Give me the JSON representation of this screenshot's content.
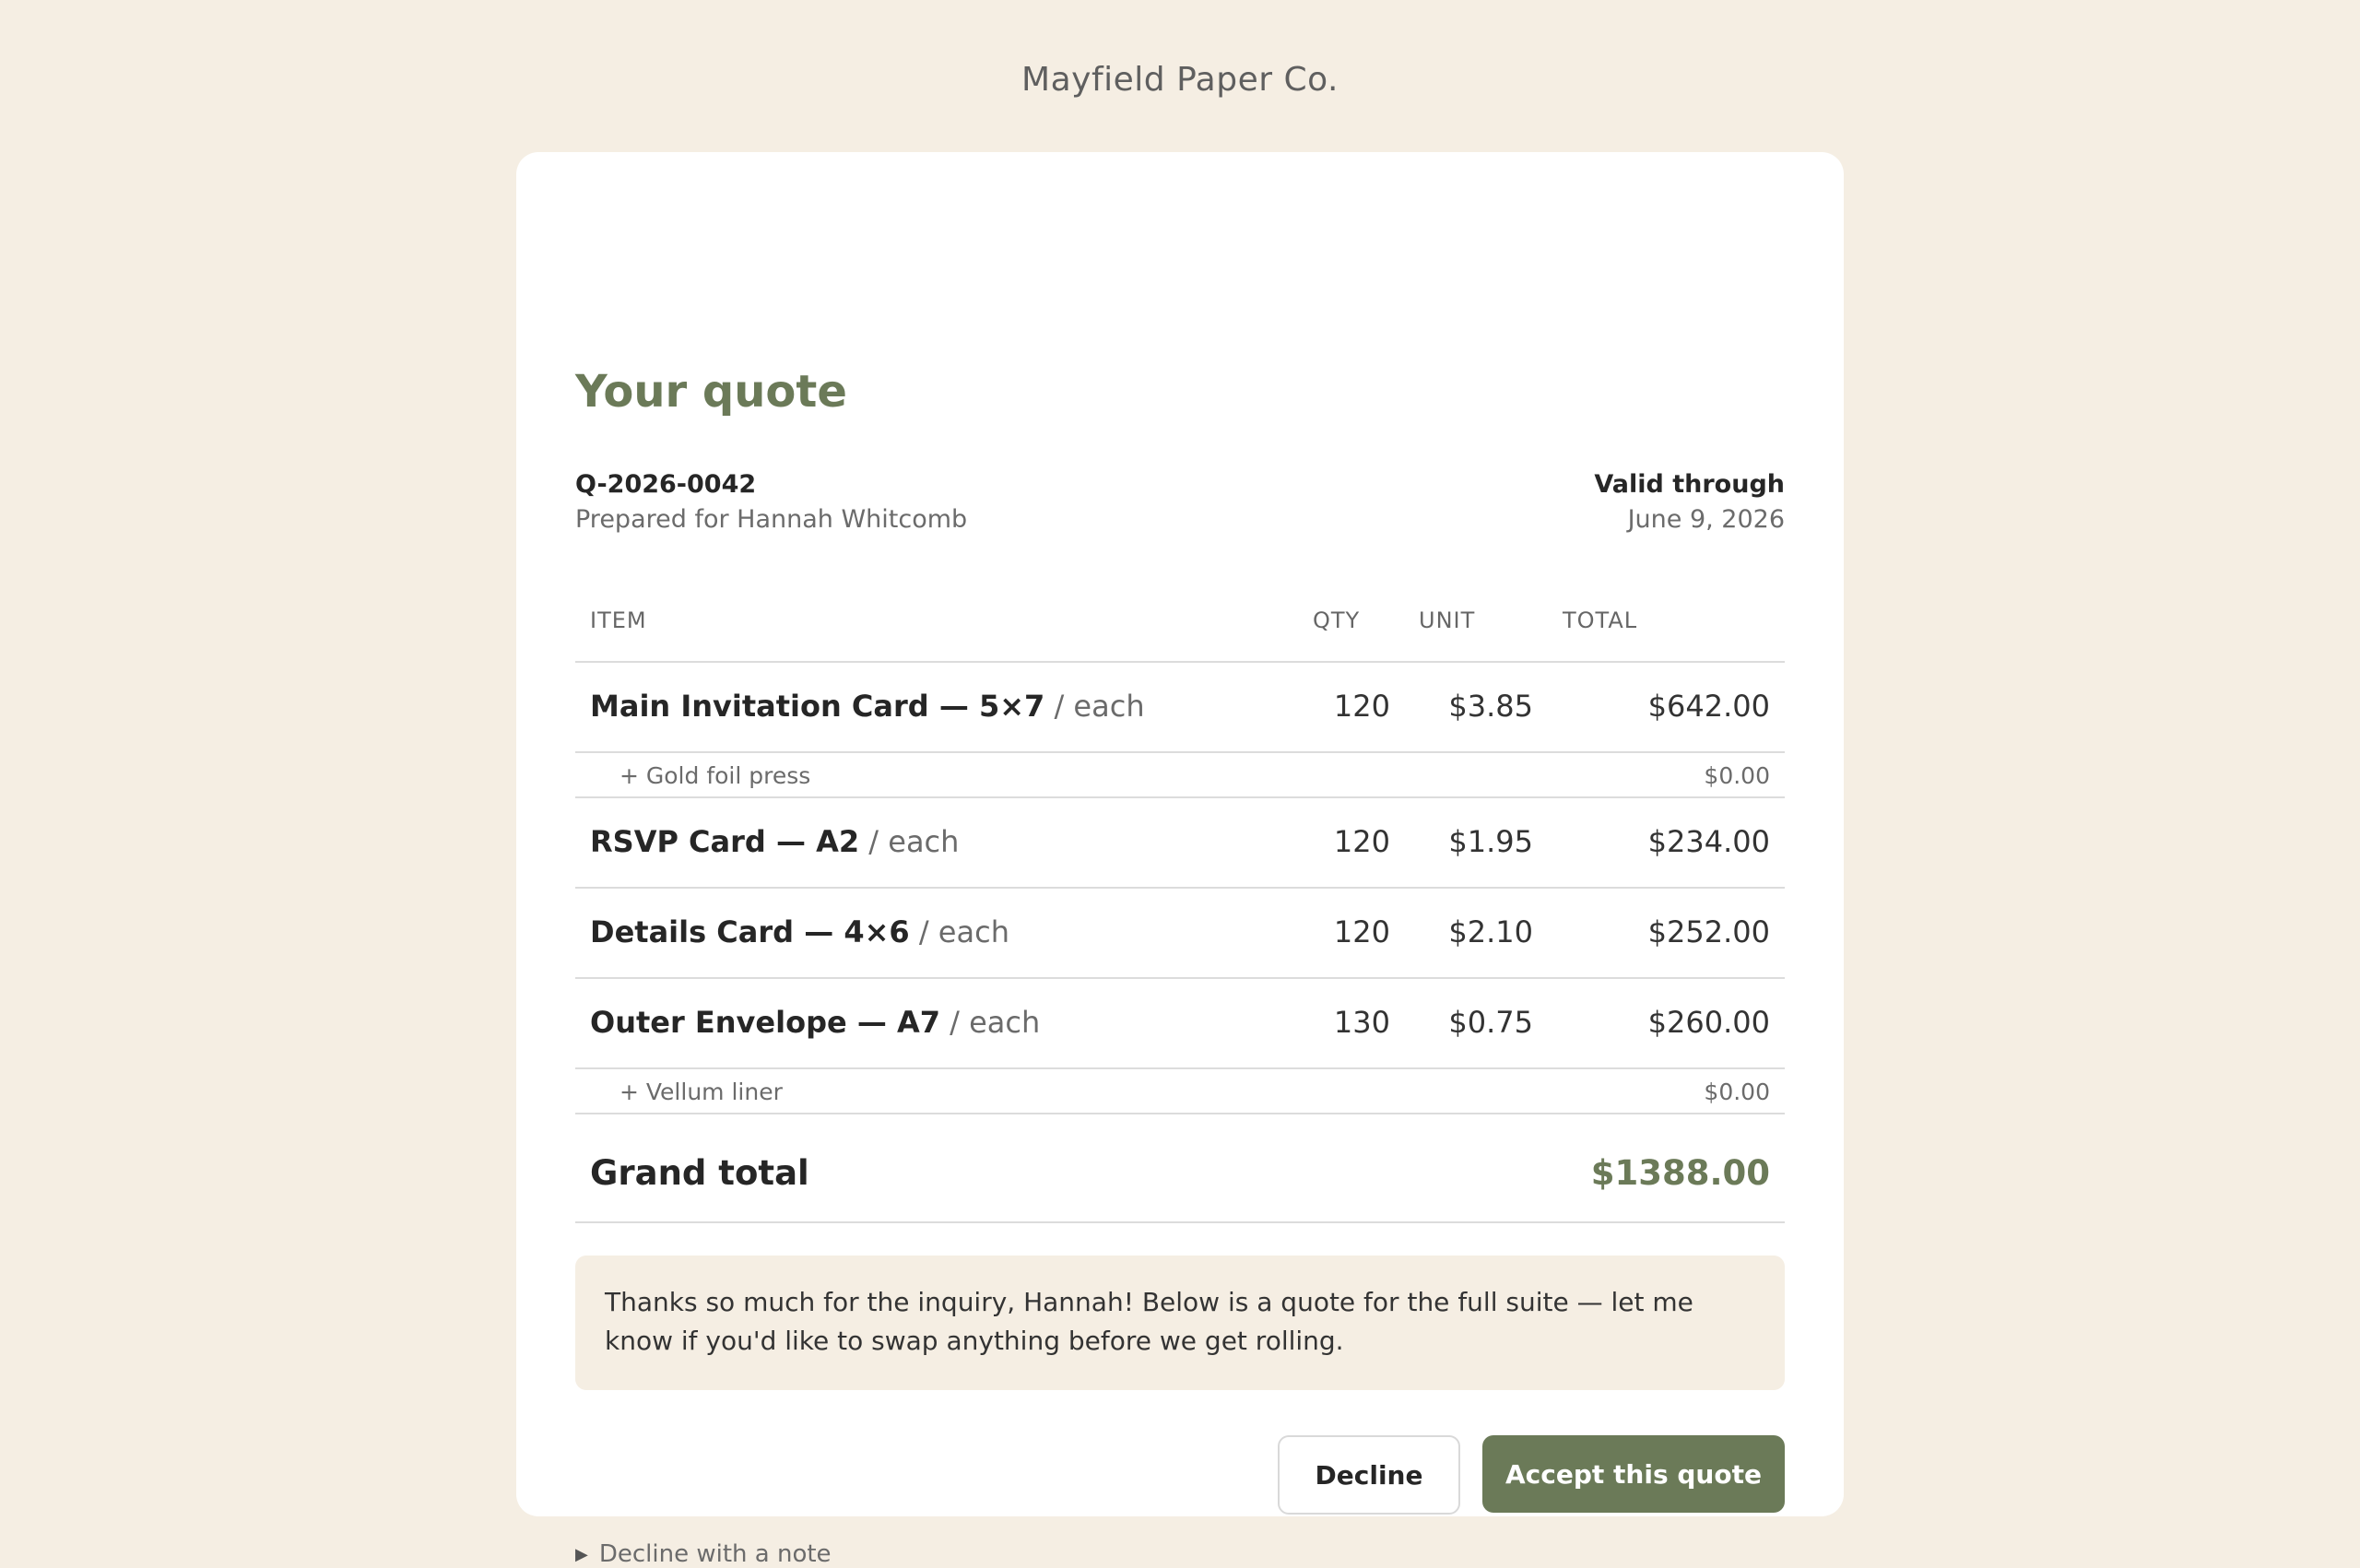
{
  "brand": "Mayfield Paper Co.",
  "quote": {
    "title": "Your quote",
    "id": "Q-2026-0042",
    "prepared_for": "Prepared for Hannah Whitcomb",
    "valid_label": "Valid through",
    "valid_date": "June 9, 2026"
  },
  "table": {
    "headers": {
      "item": "ITEM",
      "qty": "QTY",
      "unit": "UNIT",
      "total": "TOTAL"
    },
    "rows": [
      {
        "name": "Main Invitation Card — 5×7",
        "per": " / each",
        "qty": "120",
        "unit": "$3.85",
        "total": "$642.00"
      },
      {
        "name": "+ Gold foil press",
        "price": "$0.00"
      },
      {
        "name": "RSVP Card — A2",
        "per": " / each",
        "qty": "120",
        "unit": "$1.95",
        "total": "$234.00"
      },
      {
        "name": "Details Card — 4×6",
        "per": " / each",
        "qty": "120",
        "unit": "$2.10",
        "total": "$252.00"
      },
      {
        "name": "Outer Envelope — A7",
        "per": " / each",
        "qty": "130",
        "unit": "$0.75",
        "total": "$260.00"
      },
      {
        "name": "+ Vellum liner",
        "price": "$0.00"
      }
    ]
  },
  "grand_total": {
    "label": "Grand total",
    "value": "$1388.00"
  },
  "note": "Thanks so much for the inquiry, Hannah! Below is a quote for the full suite — let me know if you'd like to swap anything before we get rolling.",
  "actions": {
    "decline": "Decline",
    "accept": "Accept this quote",
    "decline_note": "Decline with a note"
  },
  "colors": {
    "accent": "#6b7a58",
    "background": "#f5eee3"
  }
}
